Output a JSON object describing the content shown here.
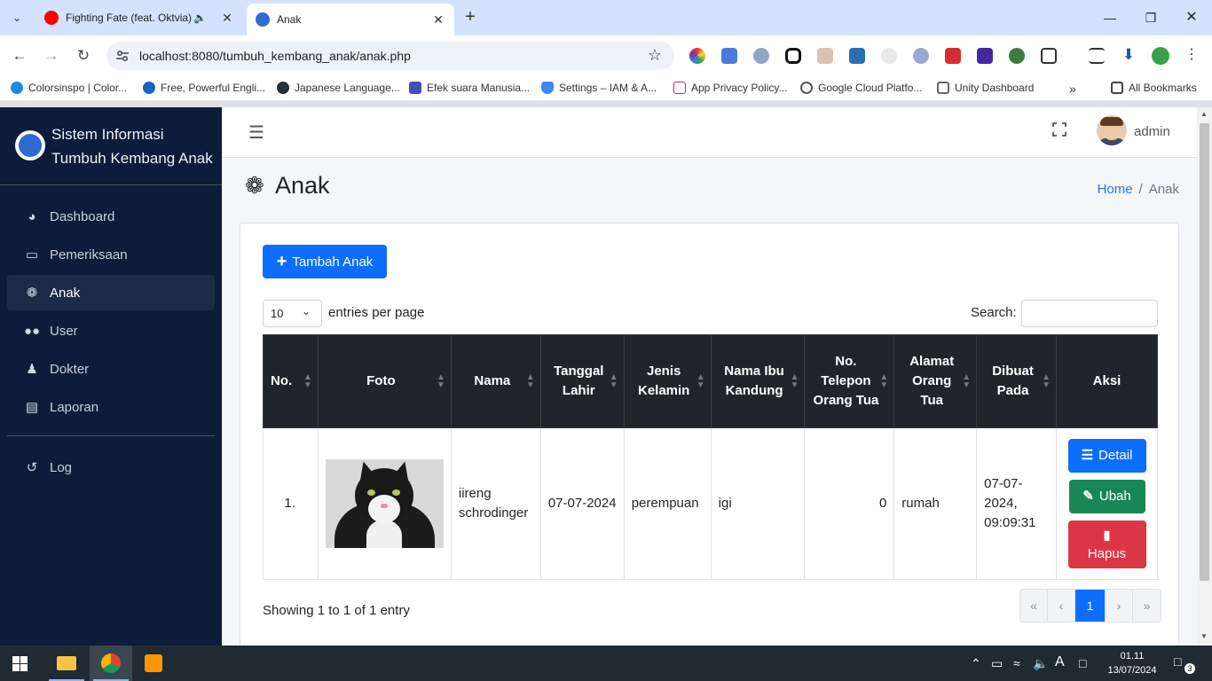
{
  "browser": {
    "tabs": [
      {
        "title": "Fighting Fate (feat. Oktvia) -",
        "icon": "youtube-icon",
        "audio": true,
        "active": false
      },
      {
        "title": "Anak",
        "icon": "app-favicon",
        "active": true
      }
    ],
    "url": "localhost:8080/tumbuh_kembang_anak/anak.php",
    "bookmarks": [
      "Colorsinspo | Color...",
      "Free, Powerful Engli...",
      "Japanese Language...",
      "Efek suara Manusia...",
      "Settings – IAM & A...",
      "App Privacy Policy...",
      "Google Cloud Platfo...",
      "Unity Dashboard"
    ],
    "all_bookmarks": "All Bookmarks",
    "extension_badge": "27"
  },
  "sidebar": {
    "brand": "Sistem Informasi Tumbuh Kembang Anak",
    "items": [
      {
        "label": "Dashboard",
        "icon": "tachometer-icon"
      },
      {
        "label": "Pemeriksaan",
        "icon": "clipboard-icon"
      },
      {
        "label": "Anak",
        "icon": "baby-icon",
        "active": true
      },
      {
        "label": "User",
        "icon": "users-icon"
      },
      {
        "label": "Dokter",
        "icon": "doctor-icon"
      },
      {
        "label": "Laporan",
        "icon": "file-icon"
      }
    ],
    "log": {
      "label": "Log",
      "icon": "history-icon"
    }
  },
  "topnav": {
    "username": "admin"
  },
  "page": {
    "title": "Anak",
    "breadcrumb_home": "Home",
    "breadcrumb_current": "Anak"
  },
  "card": {
    "add_button": "Tambah Anak",
    "page_length": "10",
    "entries_label": "entries per page",
    "search_label": "Search:",
    "search_value": ""
  },
  "table": {
    "columns": [
      "No.",
      "Foto",
      "Nama",
      "Tanggal Lahir",
      "Jenis Kelamin",
      "Nama Ibu Kandung",
      "No. Telepon Orang Tua",
      "Alamat Orang Tua",
      "Dibuat Pada",
      "Aksi"
    ],
    "rows": [
      {
        "no": "1.",
        "photo": "cat-photo",
        "nama": "iireng schrodinger",
        "tanggal_lahir": "07-07-2024",
        "jenis_kelamin": "perempuan",
        "nama_ibu": "igi",
        "telepon": "0",
        "alamat": "rumah",
        "dibuat_pada": "07-07-2024, 09:09:31"
      }
    ],
    "actions": {
      "detail": "Detail",
      "ubah": "Ubah",
      "hapus": "Hapus"
    },
    "info": "Showing 1 to 1 of 1 entry",
    "pager": {
      "first": "«",
      "prev": "‹",
      "current": "1",
      "next": "›",
      "last": "»"
    }
  },
  "taskbar": {
    "time": "01.11",
    "date": "13/07/2024",
    "notifications": "3"
  },
  "colors": {
    "sidebar_bg": "#0c1c3a",
    "primary": "#0d6efd",
    "success": "#198754",
    "danger": "#dc3545",
    "table_head": "#212529"
  }
}
